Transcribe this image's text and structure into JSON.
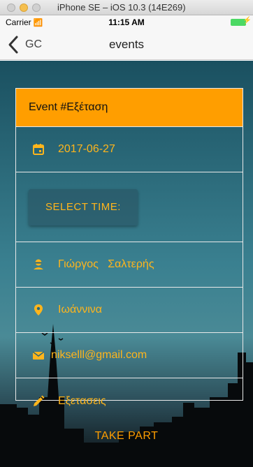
{
  "simulator": {
    "title": "iPhone SE – iOS 10.3 (14E269)"
  },
  "status_bar": {
    "carrier": "Carrier",
    "time": "11:15 AM"
  },
  "nav": {
    "back_label": "GC",
    "title": "events"
  },
  "event": {
    "header": "Event #Εξέταση",
    "date": "2017-06-27",
    "select_time_label": "SELECT TIME:",
    "person": "Γιώργος   Σαλτερής",
    "location": "Ιωάννινα",
    "email": "nikselll@gmail.com",
    "notes": "Εξετασεις"
  },
  "actions": {
    "take_part_label": "TAKE PART"
  },
  "colors": {
    "accent": "#ff9e00",
    "text_accent": "#ffb51c"
  },
  "icons": [
    "calendar-icon",
    "person-icon",
    "location-pin-icon",
    "mail-icon",
    "pencil-icon",
    "chevron-left-icon",
    "wifi-icon",
    "battery-icon"
  ]
}
